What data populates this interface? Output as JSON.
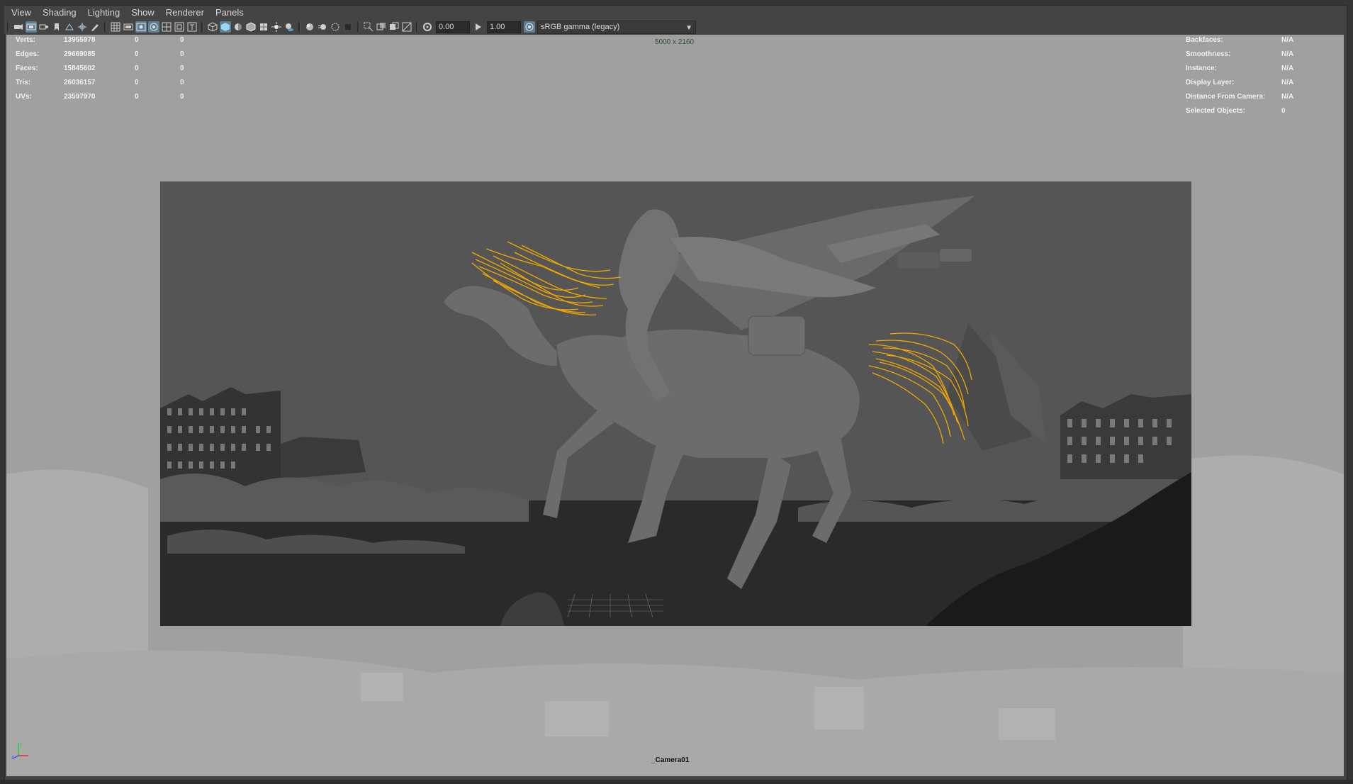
{
  "menu": [
    "View",
    "Shading",
    "Lighting",
    "Show",
    "Renderer",
    "Panels"
  ],
  "toolbar": {
    "exposure": "0.00",
    "gamma": "1.00",
    "colorspace": "sRGB gamma (legacy)"
  },
  "hud": {
    "stats": [
      {
        "label": "Verts:",
        "v1": "13955978",
        "v2": "0",
        "v3": "0"
      },
      {
        "label": "Edges:",
        "v1": "29669085",
        "v2": "0",
        "v3": "0"
      },
      {
        "label": "Faces:",
        "v1": "15845602",
        "v2": "0",
        "v3": "0"
      },
      {
        "label": "Tris:",
        "v1": "26036157",
        "v2": "0",
        "v3": "0"
      },
      {
        "label": "UVs:",
        "v1": "23597970",
        "v2": "0",
        "v3": "0"
      }
    ],
    "info": [
      {
        "label": "Backfaces:",
        "value": "N/A"
      },
      {
        "label": "Smoothness:",
        "value": "N/A"
      },
      {
        "label": "Instance:",
        "value": "N/A"
      },
      {
        "label": "Display Layer:",
        "value": "N/A"
      },
      {
        "label": "Distance From Camera:",
        "value": "N/A"
      },
      {
        "label": "Selected Objects:",
        "value": "0"
      }
    ],
    "resolution": "5000 x 2160",
    "camera": "_Camera01"
  },
  "colors": {
    "viewport_bg": "#a0a0a0",
    "gate_bg": "#525252",
    "hair_highlight": "#f0a800",
    "active_button": "#5d7f95"
  }
}
